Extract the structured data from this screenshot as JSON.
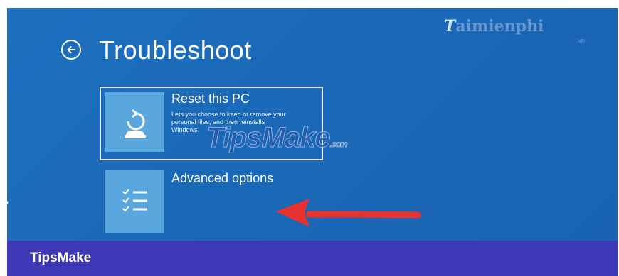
{
  "page": {
    "title": "Troubleshoot",
    "back_icon": "back-arrow-circle-icon"
  },
  "options": [
    {
      "label": "Reset this PC",
      "description": "Lets you choose to keep or remove your personal files, and then reinstalls Windows.",
      "icon": "reset-pc-icon"
    },
    {
      "label": "Advanced options",
      "description": "",
      "icon": "checklist-icon"
    }
  ],
  "watermarks": {
    "center_text": "TipsMake",
    "center_suffix": ".com",
    "corner_text": "aimienphi",
    "corner_sub": ".vn"
  },
  "annotation": {
    "arrow_color": "#e8322f",
    "points_to": "Advanced options"
  },
  "footer": {
    "brand": "TipsMake"
  },
  "colors": {
    "background": "#1d70bf",
    "tile": "#5aa6de",
    "footer": "#3e39b6",
    "arrow": "#e8322f"
  }
}
